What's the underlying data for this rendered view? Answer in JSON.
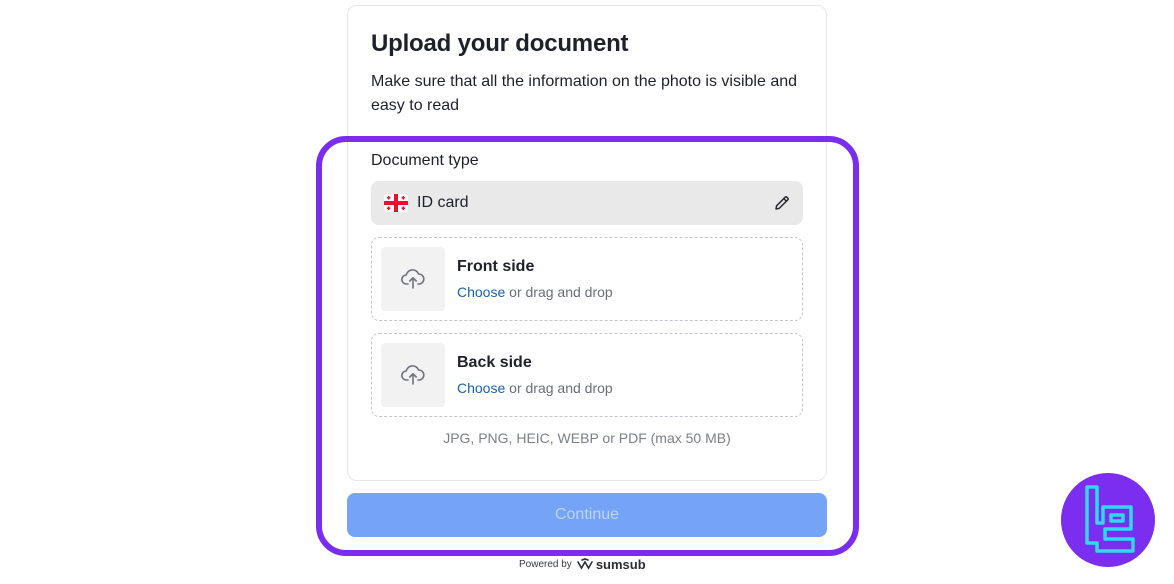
{
  "header": {
    "title": "Upload your document",
    "subtitle": "Make sure that all the information on the photo is visible and easy to read"
  },
  "document_type": {
    "label": "Document type",
    "value": "ID card",
    "flag_icon": "georgia-flag-icon",
    "edit_icon": "pencil-icon"
  },
  "uploads": [
    {
      "title": "Front side",
      "choose": "Choose",
      "rest": " or drag and drop",
      "icon": "cloud-upload-icon"
    },
    {
      "title": "Back side",
      "choose": "Choose",
      "rest": " or drag and drop",
      "icon": "cloud-upload-icon"
    }
  ],
  "formats_note": "JPG, PNG, HEIC, WEBP or PDF (max 50 MB)",
  "continue_label": "Continue",
  "footer": {
    "powered_by": "Powered by",
    "brand": "sumsub"
  },
  "colors": {
    "highlight": "#7a2cf0",
    "button": "#75a4f7",
    "link": "#1a5fb4",
    "logo_bg": "#7b2ef0",
    "logo_stroke": "#2fd9f0"
  }
}
